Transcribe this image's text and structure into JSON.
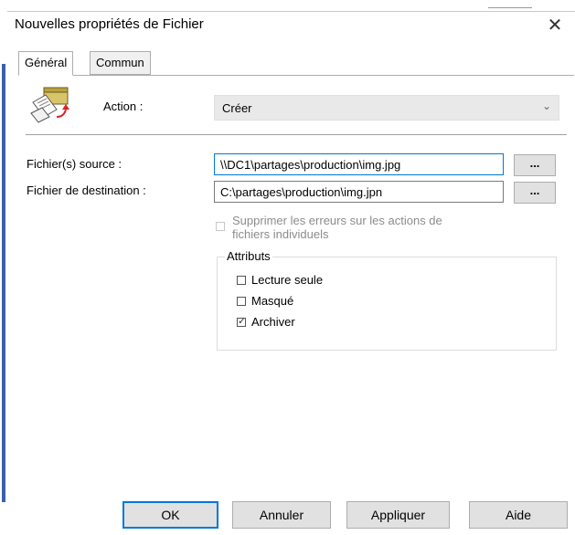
{
  "window": {
    "title": "Nouvelles propriétés de Fichier",
    "close_glyph": "✕"
  },
  "tabs": [
    {
      "label": "Général",
      "active": true
    },
    {
      "label": "Commun",
      "active": false
    }
  ],
  "action": {
    "label": "Action :",
    "value": "Créer",
    "icon": "file-folder-action-icon"
  },
  "source": {
    "label": "Fichier(s) source :",
    "value": "\\\\DC1\\partages\\production\\img.jpg",
    "browse_label": "..."
  },
  "destination": {
    "label": "Fichier de destination :",
    "value": "C:\\partages\\production\\img.jpn",
    "browse_label": "..."
  },
  "suppress_errors": {
    "line1": "Supprimer les erreurs sur les actions de",
    "line2": "fichiers individuels",
    "checked": false,
    "enabled": false
  },
  "attributes": {
    "title": "Attributs",
    "items": [
      {
        "label": "Lecture seule",
        "checked": false
      },
      {
        "label": "Masqué",
        "checked": false
      },
      {
        "label": "Archiver",
        "checked": true
      }
    ]
  },
  "buttons": {
    "ok": "OK",
    "cancel": "Annuler",
    "apply": "Appliquer",
    "help": "Aide"
  },
  "colors": {
    "focus_border": "#0078d7",
    "button_face": "#e1e1e1",
    "combo_bg": "#e9e9e9"
  }
}
